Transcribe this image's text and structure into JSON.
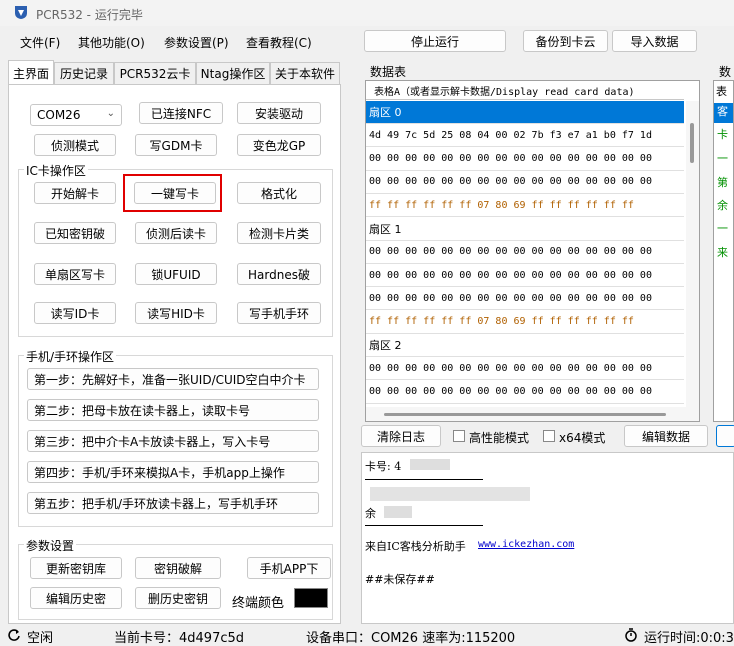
{
  "window": {
    "title": "PCR532 - 运行完毕"
  },
  "menu": [
    "文件(F)",
    "其他功能(O)",
    "参数设置(P)",
    "查看教程(C)"
  ],
  "toolbar": {
    "stop": "停止运行",
    "backup": "备份到卡云",
    "import": "导入数据"
  },
  "tabs": [
    "主界面",
    "历史记录",
    "PCR532云卡",
    "Ntag操作区",
    "关于本软件"
  ],
  "main": {
    "com_select": "COM26",
    "connected_nfc": "已连接NFC",
    "install_driver": "安装驱动",
    "detect_mode": "侦测模式",
    "write_gdm": "写GDM卡",
    "chameleon": "变色龙GP",
    "ic_group": "IC卡操作区",
    "start_decrypt": "开始解卡",
    "one_key_write": "一键写卡",
    "format": "格式化",
    "known_key_crack": "已知密钥破",
    "detect_read": "侦测后读卡",
    "check_card_type": "检测卡片类",
    "single_sector_write": "单扇区写卡",
    "lock_ufuid": "锁UFUID",
    "hardnes": "Hardnes破",
    "rw_id": "读写ID卡",
    "rw_hid": "读写HID卡",
    "write_bracelet": "写手机手环",
    "phone_group": "手机/手环操作区",
    "steps": [
      "第一步：先解好卡，准备一张UID/CUID空白中介卡",
      "第二步：把母卡放在读卡器上，读取卡号",
      "第三步：把中介卡A卡放读卡器上，写入卡号",
      "第四步：手机/手环来模拟A卡，手机app上操作",
      "第五步：把手机/手环放读卡器上，写手机手环"
    ],
    "param_group": "参数设置",
    "update_keys": "更新密钥库",
    "key_crack": "密钥破解",
    "phone_app": "手机APP下",
    "edit_history": "编辑历史密",
    "delete_history": "删历史密钥",
    "terminal_color_label": "终端颜色",
    "terminal_color": "#000000"
  },
  "grid": {
    "label": "数据表",
    "label_right": "数",
    "header": "表格A（或者显示解卡数据/Display read card data)",
    "rows": [
      {
        "text": "扇区 0",
        "kind": "sector",
        "selected": true
      },
      {
        "text": "4d 49 7c 5d 25 08 04 00 02 7b f3 e7 a1 b0 f7 1d",
        "kind": "data"
      },
      {
        "text": "00 00 00 00 00 00 00 00 00 00 00 00 00 00 00 00",
        "kind": "data"
      },
      {
        "text": "00 00 00 00 00 00 00 00 00 00 00 00 00 00 00 00",
        "kind": "data"
      },
      {
        "text": "ff ff ff ff ff ff 07 80 69 ff ff ff ff ff ff",
        "kind": "trailer"
      },
      {
        "text": "扇区 1",
        "kind": "sector"
      },
      {
        "text": "00 00 00 00 00 00 00 00 00 00 00 00 00 00 00 00",
        "kind": "data"
      },
      {
        "text": "00 00 00 00 00 00 00 00 00 00 00 00 00 00 00 00",
        "kind": "data"
      },
      {
        "text": "00 00 00 00 00 00 00 00 00 00 00 00 00 00 00 00",
        "kind": "data"
      },
      {
        "text": "ff ff ff ff ff ff 07 80 69 ff ff ff ff ff ff",
        "kind": "trailer"
      },
      {
        "text": "扇区 2",
        "kind": "sector"
      },
      {
        "text": "00 00 00 00 00 00 00 00 00 00 00 00 00 00 00 00",
        "kind": "data"
      },
      {
        "text": "00 00 00 00 00 00 00 00 00 00 00 00 00 00 00 00",
        "kind": "data"
      }
    ]
  },
  "right_strip": {
    "header": "表",
    "items": [
      "客",
      "卡",
      "一",
      "第",
      "余",
      "一",
      "来"
    ]
  },
  "bottom_toolbar": {
    "clear_log": "清除日志",
    "high_perf": "高性能模式",
    "x64": "x64模式",
    "edit_data": "编辑数据"
  },
  "log": {
    "card_label": "卡号: 4",
    "remain_label": "余",
    "source_text": "来自IC客栈分析助手",
    "source_link": "www.ickezhan.com",
    "unsaved": "##未保存##"
  },
  "status": {
    "idle": "空闲",
    "current_card": "当前卡号：4d497c5d",
    "port": "设备串口：COM26 速率为:115200",
    "runtime": "运行时间:0:0:3"
  },
  "colors": {
    "selection": "#0078d7",
    "highlight_border": "#e00000",
    "trailer_text": "#b06000",
    "link": "#0000cc"
  }
}
